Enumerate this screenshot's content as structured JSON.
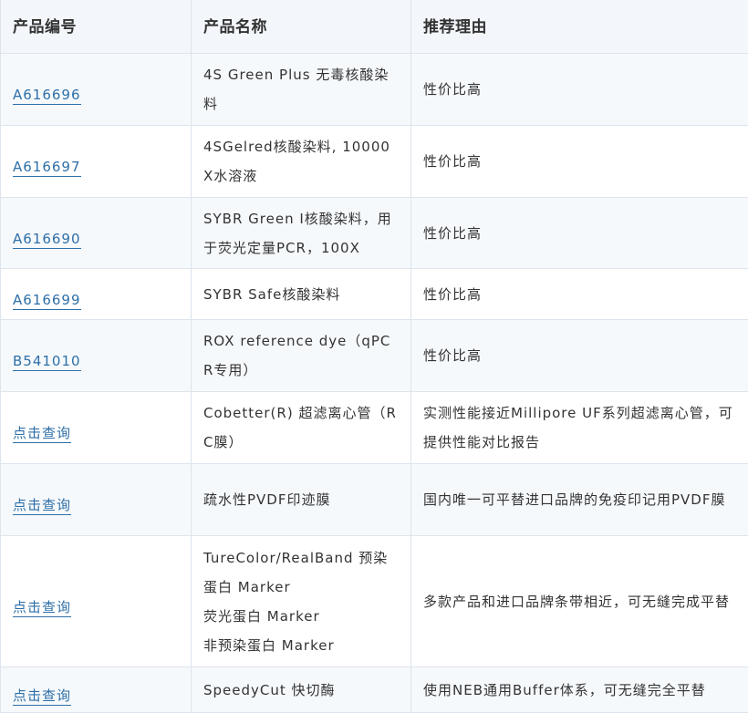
{
  "headers": [
    "产品编号",
    "产品名称",
    "推荐理由"
  ],
  "rows": [
    {
      "code": "A616696",
      "name": [
        "4S Green Plus 无毒核酸染料"
      ],
      "reason": "性价比高"
    },
    {
      "code": "A616697",
      "name": [
        "4SGelred核酸染料, 10000X水溶液"
      ],
      "reason": "性价比高"
    },
    {
      "code": "A616690",
      "name": [
        "SYBR Green I核酸染料，用于荧光定量PCR，100X"
      ],
      "reason": "性价比高"
    },
    {
      "code": "A616699",
      "name": [
        "SYBR Safe核酸染料"
      ],
      "reason": "性价比高"
    },
    {
      "code": "B541010",
      "name": [
        "ROX reference dye（qPCR专用）"
      ],
      "reason": "性价比高"
    },
    {
      "code": "点击查询",
      "name": [
        "Cobetter(R) 超滤离心管（RC膜）"
      ],
      "reason": "实测性能接近Millipore UF系列超滤离心管，可提供性能对比报告"
    },
    {
      "code": "点击查询",
      "name": [
        "疏水性PVDF印迹膜"
      ],
      "reason": "国内唯一可平替进口品牌的免疫印记用PVDF膜"
    },
    {
      "code": "点击查询",
      "name": [
        "TureColor/RealBand 预染蛋白 Marker",
        "荧光蛋白 Marker",
        "非预染蛋白 Marker"
      ],
      "reason": "多款产品和进口品牌条带相近，可无缝完成平替"
    },
    {
      "code": "点击查询",
      "name": [
        "SpeedyCut 快切酶"
      ],
      "reason": "使用NEB通用Buffer体系，可无缝完全平替"
    }
  ]
}
